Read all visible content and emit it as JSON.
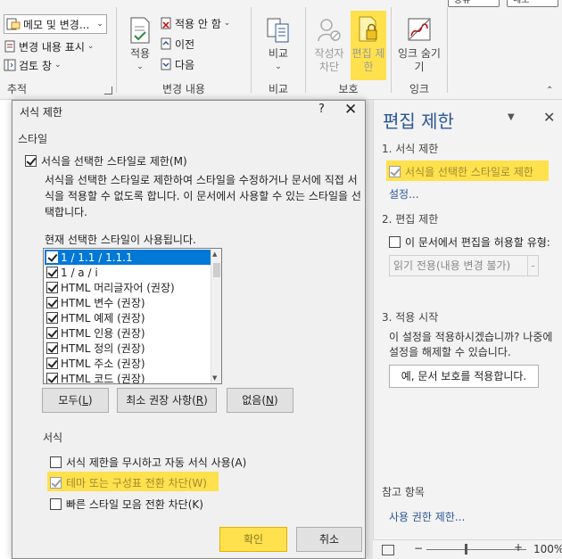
{
  "ribbon": {
    "top_buttons": [
      "공유",
      "메모"
    ],
    "tracking": {
      "markup_combo": "메모 및 변경...",
      "show_markup": "변경 내용 표시",
      "review_pane": "검토 창",
      "group_label": "추적"
    },
    "changes": {
      "accept": "적용",
      "reject": "적용 안 함",
      "previous": "이전",
      "next": "다음",
      "group_label": "변경 내용"
    },
    "compare": {
      "button": "비교",
      "group_label": "비교"
    },
    "protect": {
      "block_authors": "작성자 차단",
      "restrict_editing": "편집 제한",
      "group_label": "보호"
    },
    "ink": {
      "hide_ink": "잉크 숨기기",
      "group_label": "잉크"
    }
  },
  "dialog": {
    "title": "서식 제한",
    "help": "?",
    "close": "✕",
    "styles_section": "스타일",
    "limit_check_label": "서식을 선택한 스타일로 제한(M)",
    "description": "서식을 선택한 스타일로 제한하여 스타일을 수정하거나 문서에 직접 서식을 적용할 수 없도록 합니다. 이 문서에서 사용할 수 있는 스타일을 선택합니다.",
    "sublabel": "현재 선택한 스타일이 사용됩니다.",
    "styles": [
      "1 / 1.1 / 1.1.1",
      "1 / a / i",
      "HTML 머리글자어 (권장)",
      "HTML 변수 (권장)",
      "HTML 예제 (권장)",
      "HTML 인용 (권장)",
      "HTML 정의 (권장)",
      "HTML 주소 (권장)",
      "HTML 코드 (권장)"
    ],
    "buttons": {
      "all": "모두",
      "all_key": "L",
      "recommended": "최소 권장 사항",
      "recommended_key": "R",
      "none": "없음",
      "none_key": "N"
    },
    "formatting_section": "서식",
    "opt_autoformat": "서식 제한을 무시하고 자동 서식 사용(A)",
    "opt_theme": "테마 또는 구성표 전환 차단(W)",
    "opt_quickstyle": "빠른 스타일 모음 전환 차단(K)",
    "ok": "확인",
    "cancel": "취소"
  },
  "pane": {
    "title": "편집 제한",
    "sec1": "1. 서식 제한",
    "sec1_check": "서식을 선택한 스타일로 제한",
    "settings_link": "설정...",
    "sec2": "2. 편집 제한",
    "sec2_check": "이 문서에서 편집을 허용할 유형:",
    "editing_select": "읽기 전용(내용 변경 불가)",
    "sec3": "3. 적용 시작",
    "sec3_text_1": "이 설정을 적용하시겠습니까? 나중에",
    "sec3_text_2": "설정을 해제할 수 있습니다.",
    "apply_button": "예, 문서 보호를 적용합니다.",
    "see_also": "참고 항목",
    "permission_link": "사용 권한 제한..."
  },
  "status": {
    "minus": "−",
    "plus": "+",
    "zoom": "100%"
  },
  "colors": {
    "highlight": "#ffe14d",
    "selection": "#0078d7",
    "accent": "#2b5797"
  }
}
